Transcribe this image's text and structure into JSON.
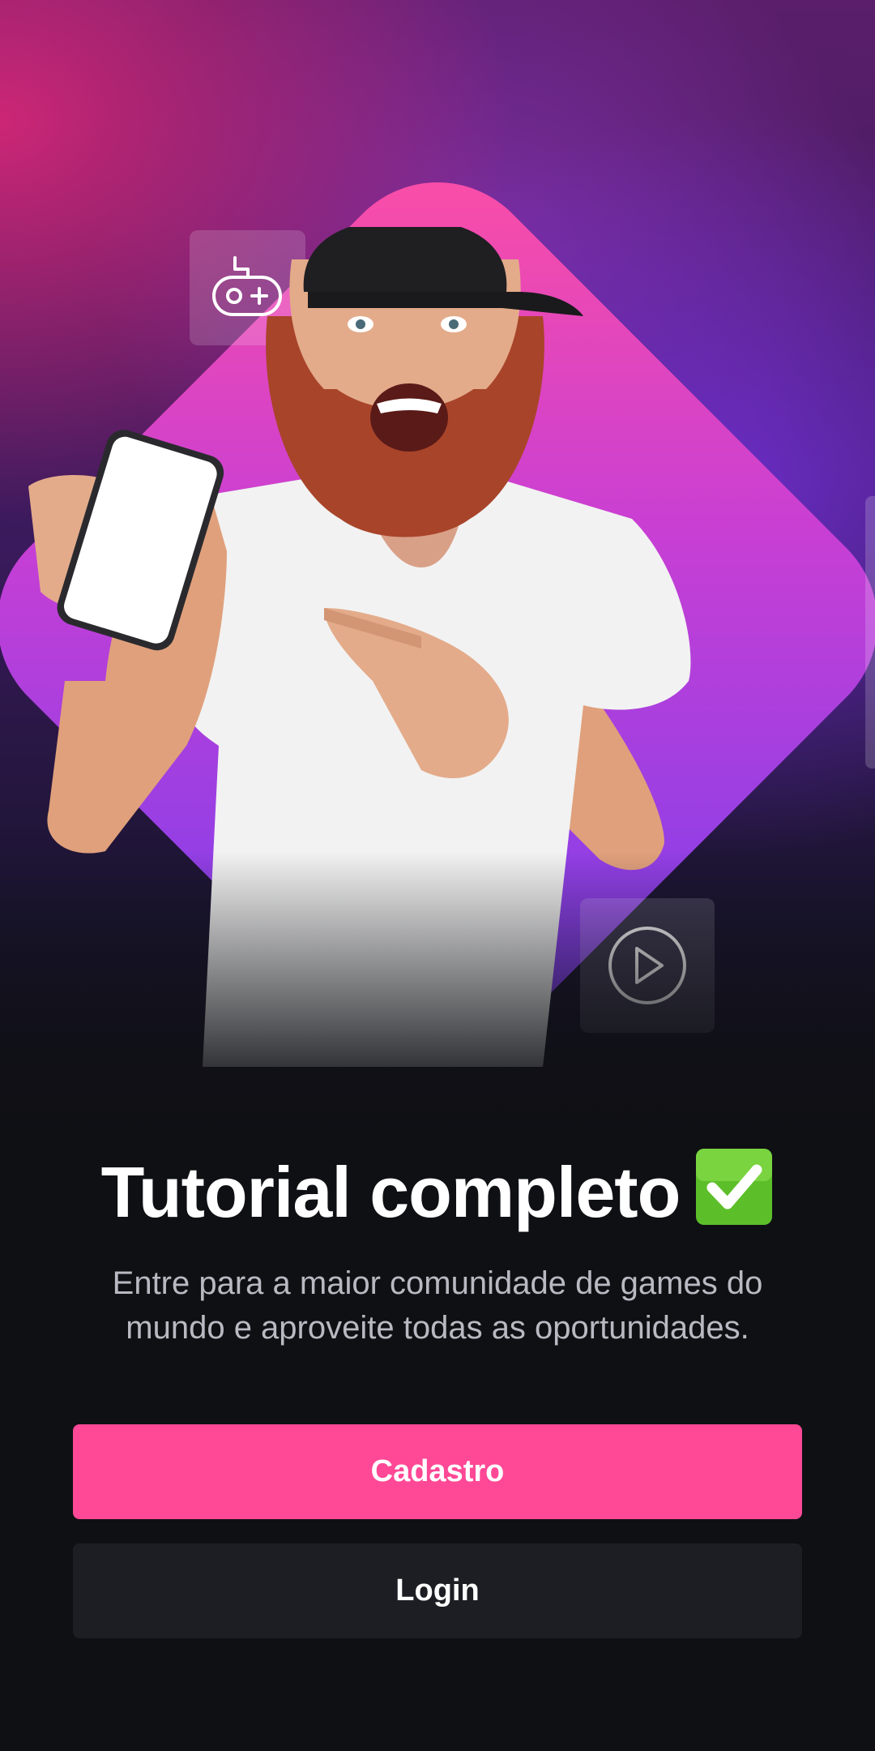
{
  "hero": {
    "title": "Tutorial completo",
    "title_icon": "check-mark-button-emoji",
    "subtitle_line1": "Entre para a maior comunidade de games do",
    "subtitle_line2": "mundo e aproveite todas as oportunidades.",
    "float_icons": [
      "gamepad-icon",
      "play-icon"
    ]
  },
  "actions": {
    "signup_label": "Cadastro",
    "login_label": "Login"
  },
  "colors": {
    "accent": "#ff4896",
    "background": "#0f1014",
    "secondary_button": "#1d1e23",
    "subtitle_text": "#b9b9c2",
    "check_green": "#5cbf2a"
  }
}
